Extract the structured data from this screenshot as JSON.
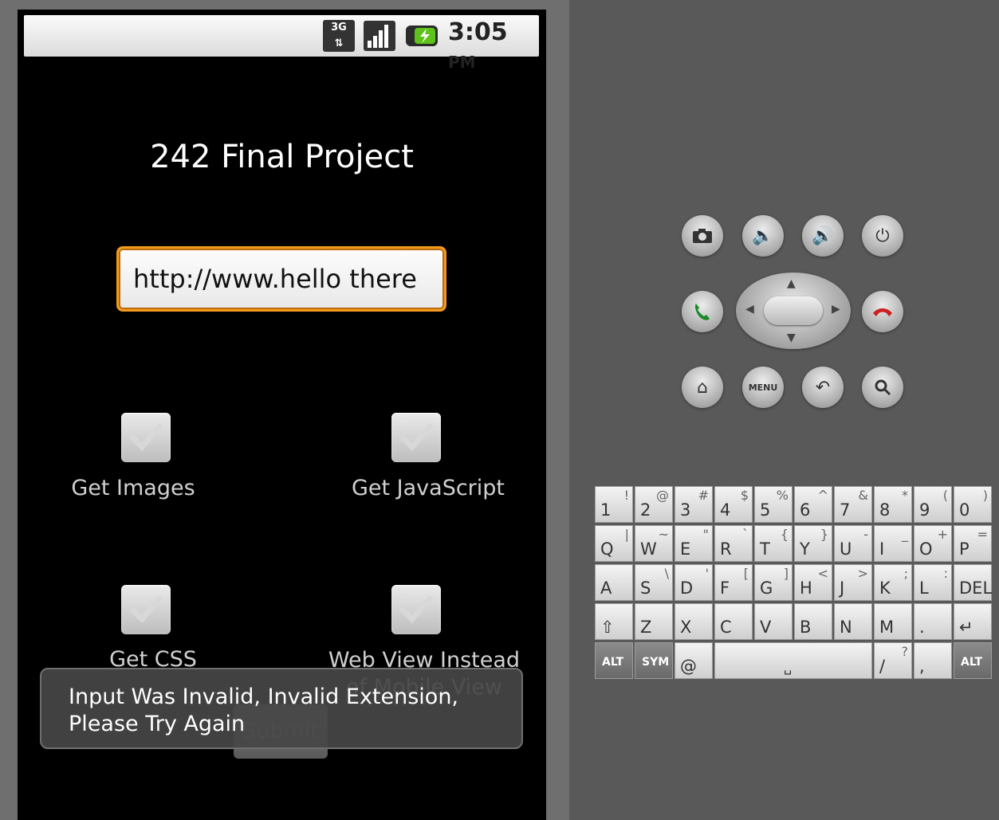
{
  "statusbar": {
    "network": "3G",
    "time": "3:05",
    "ampm": "PM"
  },
  "app": {
    "title": "242 Final Project",
    "url_value": "http://www.hello there",
    "checkboxes": [
      {
        "label": "Get Images",
        "checked": true
      },
      {
        "label": "Get JavaScript",
        "checked": true
      },
      {
        "label": "Get CSS",
        "checked": true
      },
      {
        "label": "Web View Instead of Mobile View",
        "checked": true
      }
    ],
    "submit_label": "Submit",
    "toast": "Input Was Invalid, Invalid Extension, Please Try Again"
  },
  "controls": {
    "menu_label": "MENU"
  },
  "keyboard": {
    "row1": [
      [
        "1",
        "!"
      ],
      [
        "2",
        "@"
      ],
      [
        "3",
        "#"
      ],
      [
        "4",
        "$"
      ],
      [
        "5",
        "%"
      ],
      [
        "6",
        "^"
      ],
      [
        "7",
        "&"
      ],
      [
        "8",
        "*"
      ],
      [
        "9",
        "("
      ],
      [
        "0",
        ")"
      ]
    ],
    "row2": [
      [
        "Q",
        "|"
      ],
      [
        "W",
        "~"
      ],
      [
        "E",
        "\""
      ],
      [
        "R",
        "`"
      ],
      [
        "T",
        "{"
      ],
      [
        "Y",
        "}"
      ],
      [
        "U",
        "-"
      ],
      [
        "I",
        "_"
      ],
      [
        "O",
        "+"
      ],
      [
        "P",
        "="
      ]
    ],
    "row3": [
      [
        "A",
        ""
      ],
      [
        "S",
        "\\"
      ],
      [
        "D",
        "'"
      ],
      [
        "F",
        "["
      ],
      [
        "G",
        "]"
      ],
      [
        "H",
        "<"
      ],
      [
        "J",
        ">"
      ],
      [
        "K",
        ";"
      ],
      [
        "L",
        ":"
      ],
      [
        "DEL",
        ""
      ]
    ],
    "row4": [
      [
        "⇧",
        ""
      ],
      [
        "Z",
        ""
      ],
      [
        "X",
        ""
      ],
      [
        "C",
        ""
      ],
      [
        "V",
        ""
      ],
      [
        "B",
        ""
      ],
      [
        "N",
        ""
      ],
      [
        "M",
        ""
      ],
      [
        ".",
        ""
      ],
      [
        "↵",
        ""
      ]
    ],
    "row5": {
      "alt": "ALT",
      "sym": "SYM",
      "at": "@",
      "slash": "/",
      "question": "?",
      "comma": ","
    }
  }
}
